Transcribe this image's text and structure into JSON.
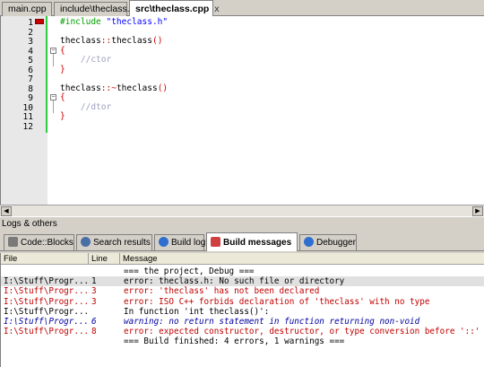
{
  "editor_tabs": [
    {
      "label": "main.cpp",
      "active": false
    },
    {
      "label": "include\\theclass.h",
      "active": false
    },
    {
      "label": "src\\theclass.cpp",
      "active": true,
      "close": "x"
    }
  ],
  "code_lines": [
    {
      "num": "1",
      "parts": [
        {
          "t": "#include ",
          "c": "kw-pre"
        },
        {
          "t": "\"theclass.h\"",
          "c": "str"
        }
      ]
    },
    {
      "num": "2",
      "parts": []
    },
    {
      "num": "3",
      "parts": [
        {
          "t": "theclass",
          "c": ""
        },
        {
          "t": "::",
          "c": "op"
        },
        {
          "t": "theclass",
          "c": ""
        },
        {
          "t": "()",
          "c": "op"
        }
      ]
    },
    {
      "num": "4",
      "parts": [
        {
          "t": "{",
          "c": "brace"
        }
      ]
    },
    {
      "num": "5",
      "parts": [
        {
          "t": "    //ctor",
          "c": "cmt"
        }
      ]
    },
    {
      "num": "6",
      "parts": [
        {
          "t": "}",
          "c": "brace"
        }
      ]
    },
    {
      "num": "7",
      "parts": []
    },
    {
      "num": "8",
      "parts": [
        {
          "t": "theclass",
          "c": ""
        },
        {
          "t": "::~",
          "c": "op"
        },
        {
          "t": "theclass",
          "c": ""
        },
        {
          "t": "()",
          "c": "op"
        }
      ]
    },
    {
      "num": "9",
      "parts": [
        {
          "t": "{",
          "c": "brace"
        }
      ]
    },
    {
      "num": "10",
      "parts": [
        {
          "t": "    //dtor",
          "c": "cmt"
        }
      ]
    },
    {
      "num": "11",
      "parts": [
        {
          "t": "}",
          "c": "brace"
        }
      ]
    },
    {
      "num": "12",
      "parts": []
    }
  ],
  "logs_header": "Logs & others",
  "log_tabs": [
    {
      "label": "Code::Blocks",
      "icon": "code-blocks-icon",
      "color": "#7a7a7a",
      "active": false
    },
    {
      "label": "Search results",
      "icon": "search-icon",
      "color": "#4a6fa5",
      "active": false
    },
    {
      "label": "Build log",
      "icon": "build-log-icon",
      "color": "#2f6fd0",
      "active": false
    },
    {
      "label": "Build messages",
      "icon": "build-messages-icon",
      "color": "#d04040",
      "active": true
    },
    {
      "label": "Debugger",
      "icon": "debugger-icon",
      "color": "#2f6fd0",
      "active": false
    }
  ],
  "table": {
    "headers": {
      "file": "File",
      "line": "Line",
      "message": "Message"
    },
    "rows": [
      {
        "file": "",
        "line": "",
        "message": "=== the project, Debug ===",
        "kind": "info",
        "selected": false
      },
      {
        "file": "I:\\Stuff\\Progr...",
        "line": "1",
        "message": "error: theclass.h: No such file or directory",
        "kind": "info",
        "selected": true
      },
      {
        "file": "I:\\Stuff\\Progr...",
        "line": "3",
        "message": "error: 'theclass' has not been declared",
        "kind": "error",
        "selected": false
      },
      {
        "file": "I:\\Stuff\\Progr...",
        "line": "3",
        "message": "error: ISO C++ forbids declaration of 'theclass' with no type",
        "kind": "error",
        "selected": false
      },
      {
        "file": "I:\\Stuff\\Progr...",
        "line": "",
        "message": "In function 'int theclass()':",
        "kind": "info",
        "selected": false
      },
      {
        "file": "I:\\Stuff\\Progr...",
        "line": "6",
        "message": "warning: no return statement in function returning non-void",
        "kind": "warn",
        "selected": false
      },
      {
        "file": "I:\\Stuff\\Progr...",
        "line": "8",
        "message": "error: expected constructor, destructor, or type conversion before '::' token",
        "kind": "error",
        "selected": false
      },
      {
        "file": "",
        "line": "",
        "message": "=== Build finished: 4 errors, 1 warnings ===",
        "kind": "info",
        "selected": false
      }
    ]
  }
}
